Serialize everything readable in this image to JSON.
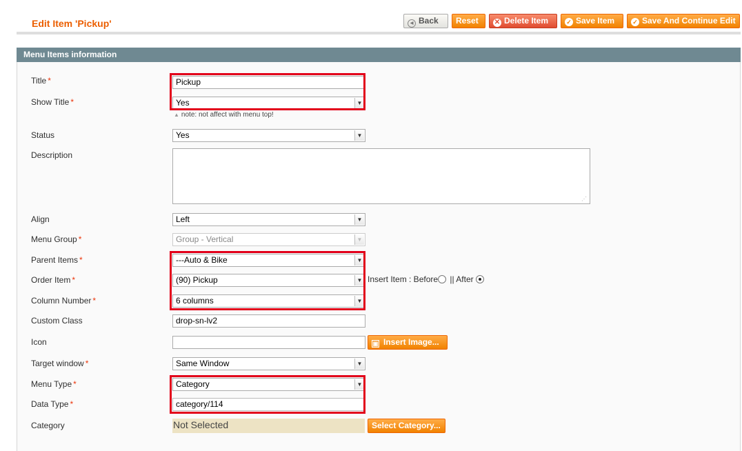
{
  "header": {
    "title": "Edit Item 'Pickup'",
    "buttons": {
      "back": "Back",
      "reset": "Reset",
      "delete": "Delete Item",
      "save": "Save Item",
      "save_continue": "Save And Continue Edit"
    }
  },
  "section": {
    "title": "Menu Items information"
  },
  "form": {
    "title": {
      "label": "Title",
      "value": "Pickup"
    },
    "show_title": {
      "label": "Show Title",
      "value": "Yes",
      "note": "note: not affect with menu top!"
    },
    "status": {
      "label": "Status",
      "value": "Yes"
    },
    "description": {
      "label": "Description",
      "value": ""
    },
    "align": {
      "label": "Align",
      "value": "Left"
    },
    "menu_group": {
      "label": "Menu Group",
      "value": "Group - Vertical"
    },
    "parent_items": {
      "label": "Parent Items",
      "value": "---Auto & Bike"
    },
    "order_item": {
      "label": "Order Item",
      "value": "(90) Pickup",
      "insert_label": "Insert Item : Before",
      "separator": "|| After",
      "selected": "After"
    },
    "column_number": {
      "label": "Column Number",
      "value": "6 columns"
    },
    "custom_class": {
      "label": "Custom Class",
      "value": "drop-sn-lv2"
    },
    "icon": {
      "label": "Icon",
      "value": "",
      "button": "Insert Image..."
    },
    "target_window": {
      "label": "Target window",
      "value": "Same Window"
    },
    "menu_type": {
      "label": "Menu Type",
      "value": "Category"
    },
    "data_type": {
      "label": "Data Type",
      "value": "category/114"
    },
    "category": {
      "label": "Category",
      "value": "Not Selected",
      "button": "Select Category..."
    },
    "required_mark": "*"
  },
  "colors": {
    "accent": "#eb5e00",
    "button": "#f18200",
    "highlight": "#e2001a",
    "section_header": "#6f8992"
  }
}
